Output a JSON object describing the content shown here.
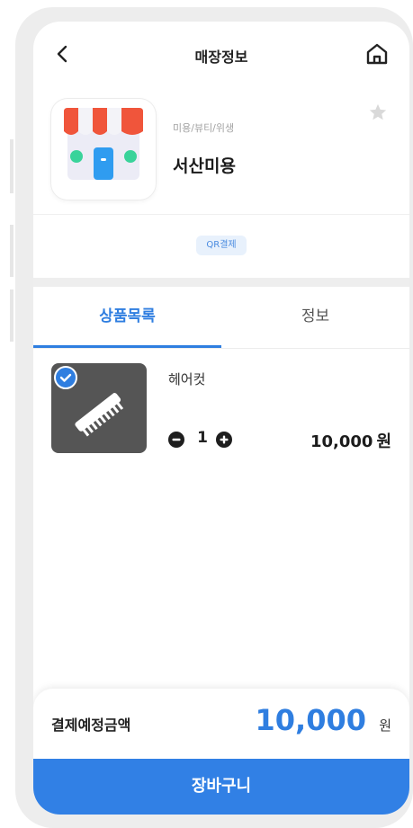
{
  "header": {
    "title": "매장정보"
  },
  "store": {
    "category": "미용/뷰티/위생",
    "name": "서산미용",
    "payment_badge": "QR결제"
  },
  "tabs": [
    {
      "label": "상품목록",
      "active": true
    },
    {
      "label": "정보",
      "active": false
    }
  ],
  "products": [
    {
      "name": "헤어컷",
      "quantity": "1",
      "price": "10,000",
      "price_unit": "원",
      "selected": true
    }
  ],
  "summary": {
    "label": "결제예정금액",
    "amount": "10,000",
    "unit": "원"
  },
  "cart_button": {
    "label": "장바구니"
  },
  "colors": {
    "accent": "#2f7ee0",
    "button": "#3180e5",
    "thumb_bg": "#555555",
    "awning_red": "#f0553b"
  },
  "icons": [
    "back-arrow-icon",
    "home-icon",
    "store-icon",
    "star-icon",
    "check-icon",
    "comb-icon",
    "minus-circle-icon",
    "plus-circle-icon"
  ]
}
